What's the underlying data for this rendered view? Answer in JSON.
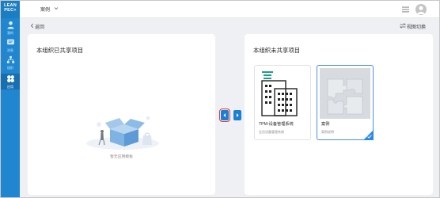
{
  "logo": {
    "line1": "LEAN",
    "line2": "PEC"
  },
  "sidebar": {
    "items": [
      {
        "label": "我的",
        "icon": "user-icon"
      },
      {
        "label": "消息",
        "icon": "message-icon"
      },
      {
        "label": "组织",
        "icon": "org-icon"
      },
      {
        "label": "应用",
        "icon": "apps-icon",
        "active": true
      }
    ]
  },
  "header": {
    "org_name": "案例",
    "menu_icon": "hamburger-icon",
    "avatar_icon": "avatar-icon"
  },
  "toolbar": {
    "back_label": "返回",
    "view_switch_label": "视图切换"
  },
  "left_panel": {
    "title": "本组织已共享项目",
    "empty_text": "暂无应用模板"
  },
  "right_panel": {
    "title": "本组织未共享项目",
    "cards": [
      {
        "name": "TPM-设备管理系统",
        "desc": "全员设备管理系统",
        "selected": false
      },
      {
        "name": "案例",
        "desc": "案例说明",
        "selected": true
      }
    ]
  },
  "transfer": {
    "left_icon": "chevron-left-icon",
    "right_icon": "chevron-right-icon"
  },
  "colors": {
    "sidebar": "#1f86cf",
    "accent": "#1b7fd6",
    "highlight": "#e53935",
    "background": "#eef0f3"
  }
}
